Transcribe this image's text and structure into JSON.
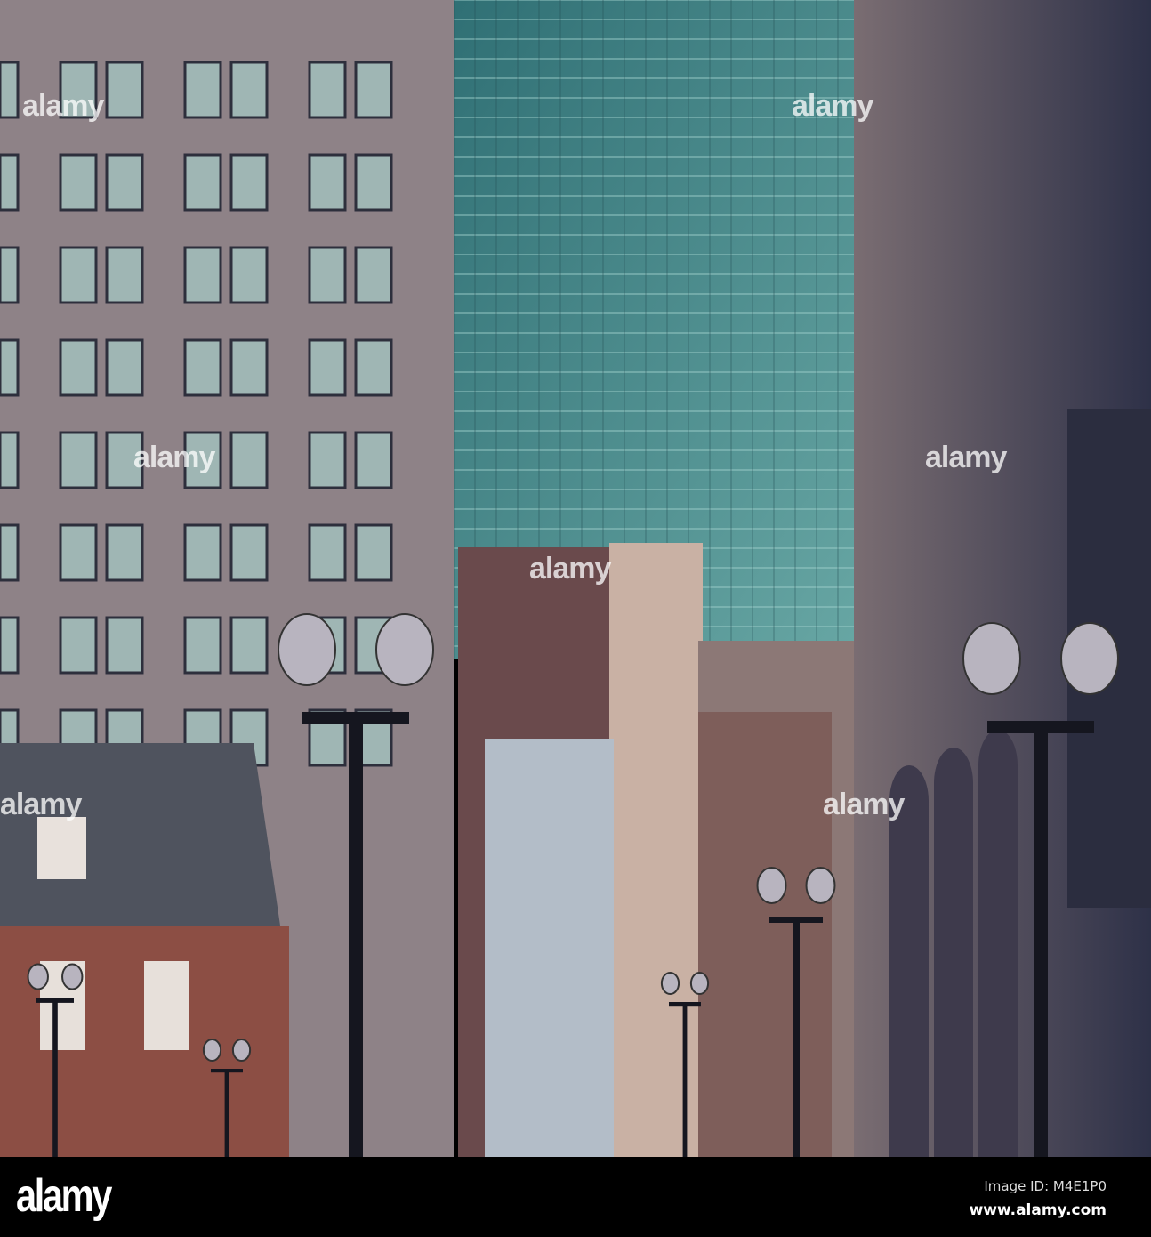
{
  "photo": {
    "subject": "city street with buildings and lamp posts"
  },
  "watermark": {
    "text": "alamy"
  },
  "footer": {
    "logo": "alamy",
    "image_id": "Image ID: M4E1P0",
    "url": "www.alamy.com"
  },
  "colors": {
    "glass": "#4f8f8e",
    "stone": "#8c8085",
    "brick": "#8a4f45",
    "sky_shadow": "#3a3f55"
  }
}
